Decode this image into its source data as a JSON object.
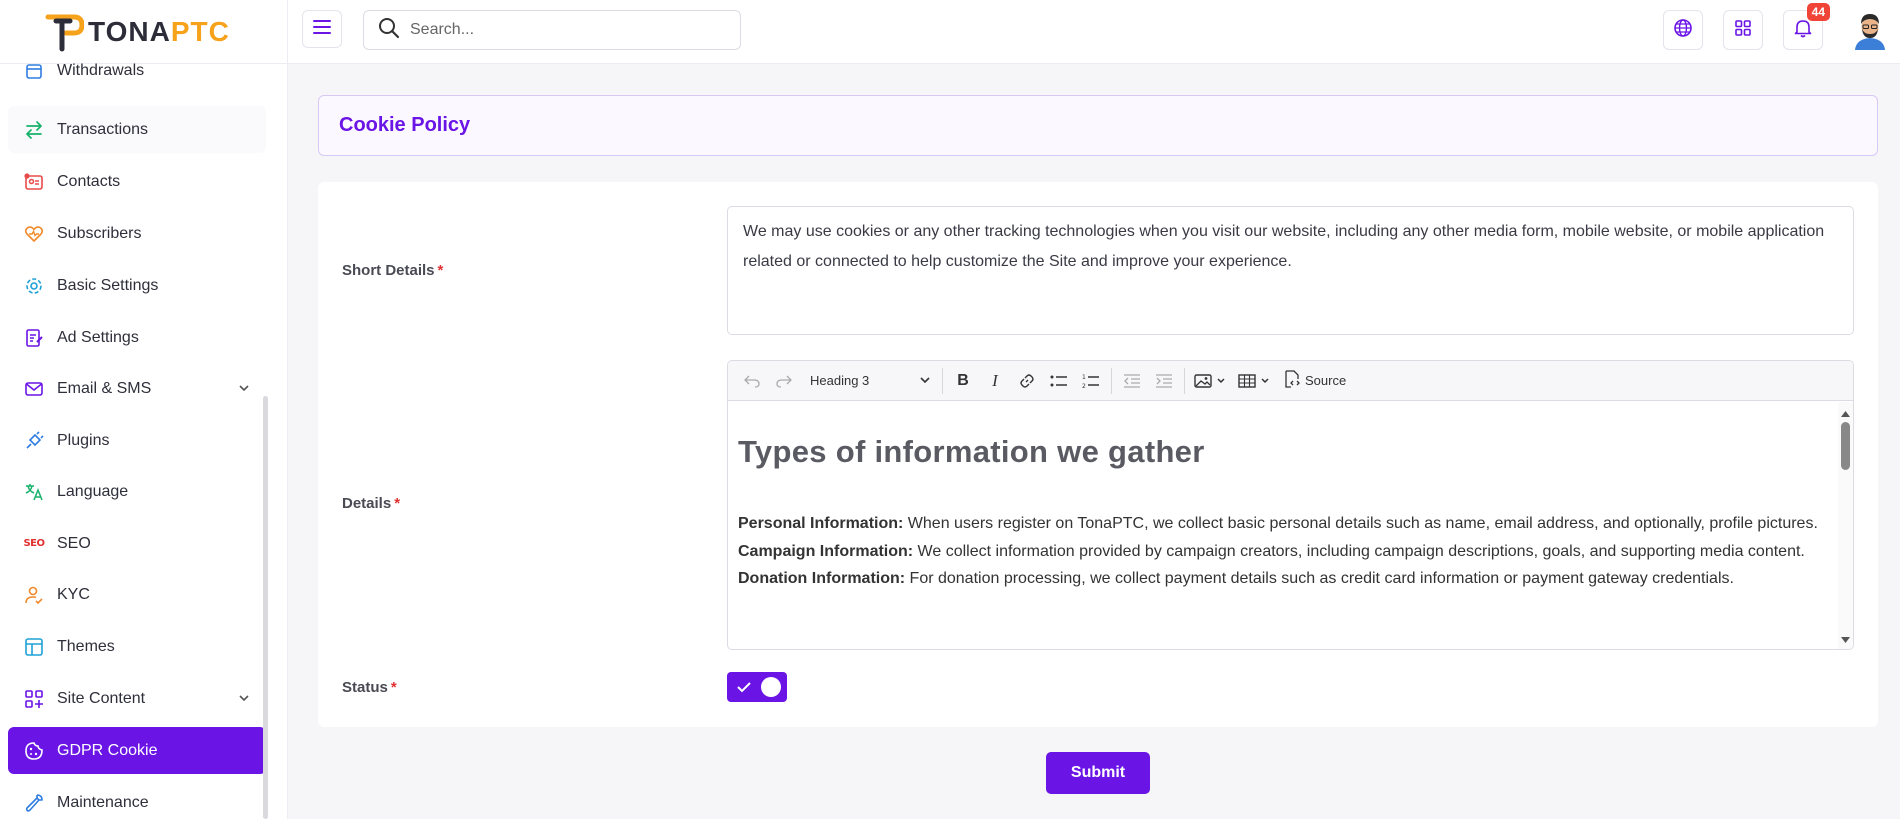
{
  "app": {
    "logo_left": "TONA",
    "logo_right": "PTC"
  },
  "colors": {
    "accent": "#6a14e6",
    "logo_orange": "#f7a21b",
    "required": "#e03030",
    "badge": "#f04438"
  },
  "sidebar": {
    "items": [
      {
        "label": "Withdrawals",
        "icon": "calendar-icon"
      },
      {
        "label": "Transactions",
        "icon": "arrows-exchange-icon"
      },
      {
        "label": "Contacts",
        "icon": "contact-card-icon"
      },
      {
        "label": "Subscribers",
        "icon": "heart-icon"
      },
      {
        "label": "Basic Settings",
        "icon": "gear-icon"
      },
      {
        "label": "Ad Settings",
        "icon": "edit-list-icon"
      },
      {
        "label": "Email & SMS",
        "icon": "mail-icon"
      },
      {
        "label": "Plugins",
        "icon": "plug-icon"
      },
      {
        "label": "Language",
        "icon": "translate-icon"
      },
      {
        "label": "SEO",
        "icon": "seo-icon"
      },
      {
        "label": "KYC",
        "icon": "user-check-icon"
      },
      {
        "label": "Themes",
        "icon": "layout-icon"
      },
      {
        "label": "Site Content",
        "icon": "grid-plus-icon"
      },
      {
        "label": "GDPR Cookie",
        "icon": "cookie-icon"
      },
      {
        "label": "Maintenance",
        "icon": "wrench-icon"
      }
    ]
  },
  "header": {
    "search_placeholder": "Search...",
    "notification_count": "44"
  },
  "page": {
    "title": "Cookie Policy"
  },
  "form": {
    "short_details_label": "Short Details",
    "short_details_value": "We may use cookies or any other tracking technologies when you visit our website, including any other media form, mobile website, or mobile application related or connected to help customize the Site and improve your experience.",
    "details_label": "Details",
    "status_label": "Status",
    "required_mark": "*",
    "status_on": true,
    "submit_label": "Submit"
  },
  "editor": {
    "heading_select": "Heading 3",
    "source_label": "Source",
    "heading": "Types of information we gather",
    "paragraphs": [
      {
        "bold": "Personal Information:",
        "text": " When users register on TonaPTC, we collect basic personal details such as name, email address, and optionally, profile pictures."
      },
      {
        "bold": "Campaign Information:",
        "text": " We collect information provided by campaign creators, including campaign descriptions, goals, and supporting media content."
      },
      {
        "bold": "Donation Information:",
        "text": " For donation processing, we collect payment details such as credit card information or payment gateway credentials."
      }
    ]
  }
}
